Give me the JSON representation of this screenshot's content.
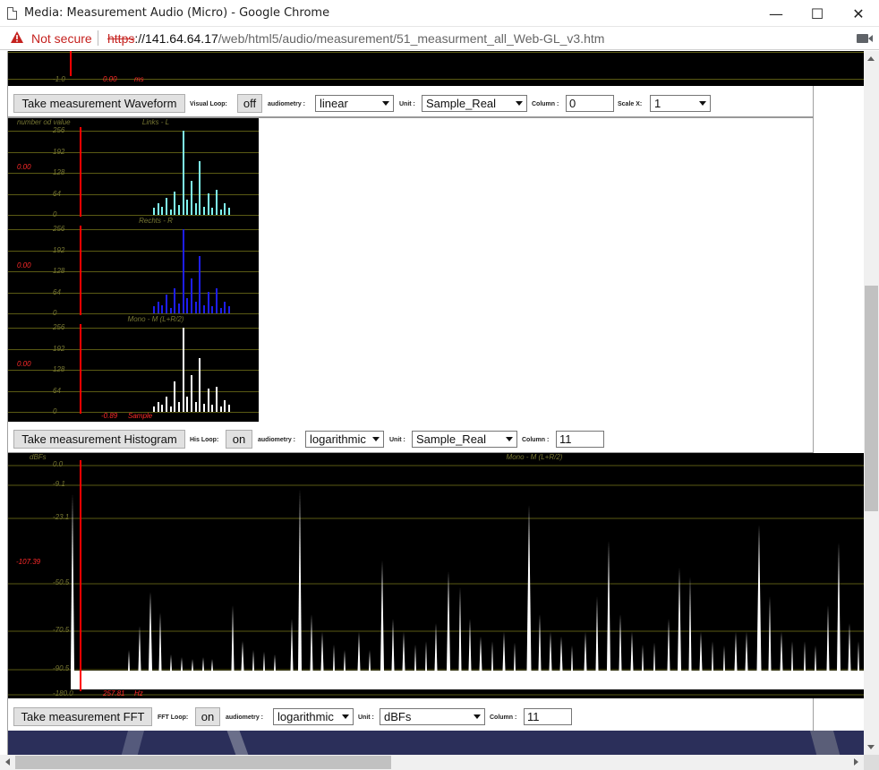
{
  "window": {
    "title": "Media: Measurement Audio (Micro) - Google Chrome",
    "minimize": "—",
    "maximize": "☐",
    "close": "✕"
  },
  "address": {
    "security_label": "Not secure",
    "scheme": "https",
    "host": "://141.64.64.17",
    "path": "/web/html5/audio/measurement/51_measurment_all_Web-GL_v3.htm"
  },
  "waveform": {
    "y_min_label": "-1.0",
    "cursor_value": "0.00",
    "cursor_unit": "ms",
    "controls": {
      "button": "Take measurement Waveform",
      "loop_label": "Visual Loop:",
      "loop_value": "off",
      "audiometry_label": "audiometry :",
      "audiometry_value": "linear",
      "unit_label": "Unit :",
      "unit_value": "Sample_Real",
      "column_label": "Column :",
      "column_value": "0",
      "scale_label": "Scale X:",
      "scale_value": "1"
    }
  },
  "histogram": {
    "y_axis_title": "number od value",
    "y_ticks": [
      "256",
      "192",
      "128",
      "64",
      "0"
    ],
    "x_cursor_value": "-0.89",
    "x_unit": "Sample",
    "channels": [
      {
        "name": "Links - L",
        "cursor_value": "0.00",
        "color": "#7ff5f0",
        "bars": [
          8,
          14,
          10,
          20,
          6,
          28,
          12,
          100,
          18,
          40,
          14,
          64,
          10,
          26,
          8,
          30,
          6,
          14,
          8
        ]
      },
      {
        "name": "Rechts - R",
        "cursor_value": "0.00",
        "color": "#1e1ef0",
        "bars": [
          8,
          14,
          10,
          22,
          6,
          30,
          12,
          100,
          18,
          42,
          14,
          68,
          10,
          26,
          8,
          30,
          6,
          14,
          8
        ]
      },
      {
        "name": "Mono - M (L+R/2)",
        "cursor_value": "0.00",
        "color": "#ffffff",
        "bars": [
          6,
          12,
          8,
          18,
          6,
          36,
          12,
          100,
          18,
          44,
          12,
          64,
          10,
          28,
          8,
          30,
          6,
          14,
          8
        ]
      }
    ],
    "controls": {
      "button": "Take measurement Histogram",
      "loop_label": "His Loop:",
      "loop_value": "on",
      "audiometry_label": "audiometry :",
      "audiometry_value": "logarithmic",
      "unit_label": "Unit :",
      "unit_value": "Sample_Real",
      "column_label": "Column :",
      "column_value": "11"
    }
  },
  "fft": {
    "y_axis_title": "dBFs",
    "channel_name": "Mono - M (L+R/2)",
    "y_ticks": [
      "0.0",
      "-9.1",
      "-23.1",
      "-50.5",
      "-70.5",
      "-90.5",
      "-180.0"
    ],
    "cursor_value": "-107.39",
    "cursor_freq": "257.81",
    "freq_unit": "Hz",
    "controls": {
      "button": "Take measurement FFT",
      "loop_label": "FFT Loop:",
      "loop_value": "on",
      "audiometry_label": "audiometry :",
      "audiometry_value": "logarithmic",
      "unit_label": "Unit :",
      "unit_value": "dBFs",
      "column_label": "Column :",
      "column_value": "11"
    }
  }
}
